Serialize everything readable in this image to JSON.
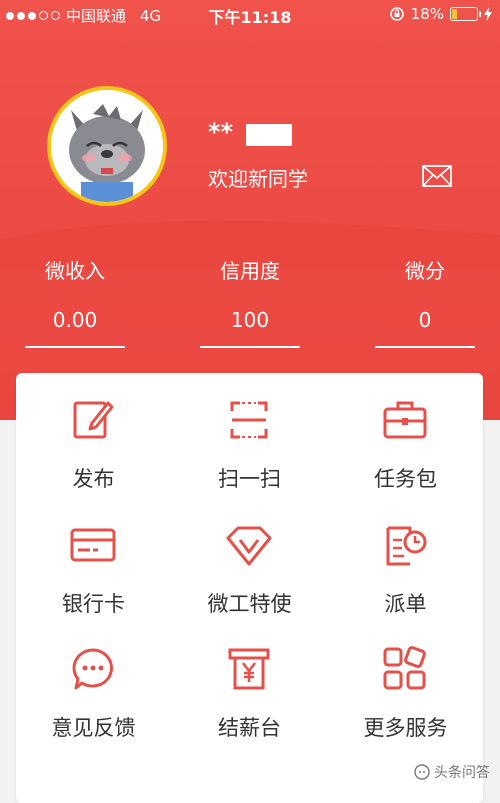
{
  "status_bar": {
    "carrier": "中国联通",
    "network": "4G",
    "time": "下午11:18",
    "battery": "18%"
  },
  "profile": {
    "username": "**",
    "welcome": "欢迎新同学"
  },
  "stats": [
    {
      "label": "微收入",
      "value": "0.00"
    },
    {
      "label": "信用度",
      "value": "100"
    },
    {
      "label": "微分",
      "value": "0"
    }
  ],
  "menu": [
    {
      "label": "发布",
      "icon": "edit-icon"
    },
    {
      "label": "扫一扫",
      "icon": "scan-icon"
    },
    {
      "label": "任务包",
      "icon": "briefcase-icon"
    },
    {
      "label": "银行卡",
      "icon": "bank-card-icon"
    },
    {
      "label": "微工特使",
      "icon": "diamond-icon"
    },
    {
      "label": "派单",
      "icon": "order-clock-icon"
    },
    {
      "label": "意见反馈",
      "icon": "chat-bubble-icon"
    },
    {
      "label": "结薪台",
      "icon": "yen-machine-icon"
    },
    {
      "label": "更多服务",
      "icon": "grid-icon"
    }
  ],
  "watermark": "头条问答",
  "colors": {
    "primary": "#e9463f",
    "icon": "#e5504a"
  }
}
